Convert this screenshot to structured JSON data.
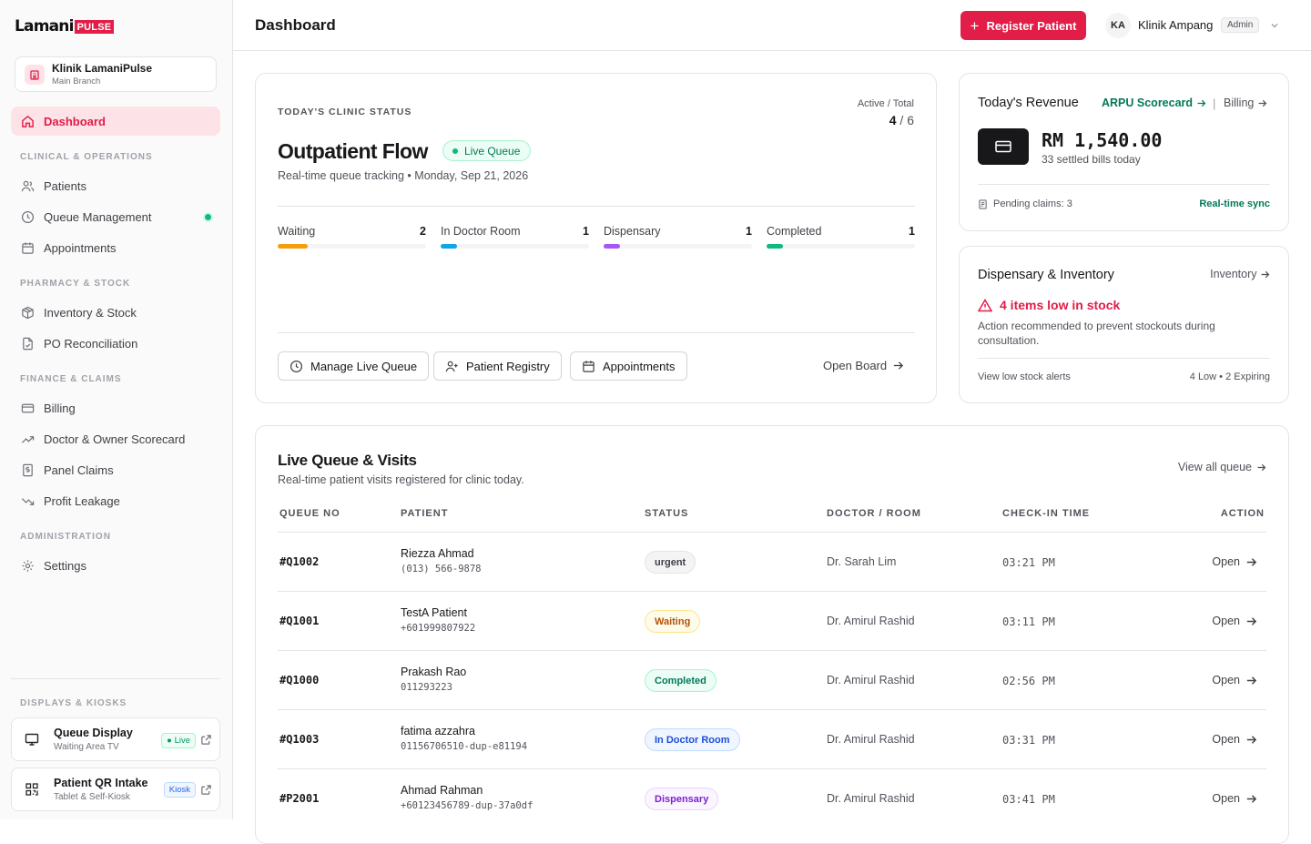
{
  "brand": {
    "name": "Lamani",
    "pulse": "PULSE",
    "accent": "#e11d48"
  },
  "branch": {
    "name": "Klinik LamaniPulse",
    "sub": "Main Branch"
  },
  "sidebar": {
    "dashboard": "Dashboard",
    "sections": {
      "clinical": "CLINICAL & OPERATIONS",
      "pharmacy": "PHARMACY & STOCK",
      "finance": "FINANCE & CLAIMS",
      "admin": "ADMINISTRATION",
      "displays": "DISPLAYS & KIOSKS"
    },
    "items": {
      "patients": "Patients",
      "queue": "Queue Management",
      "appointments": "Appointments",
      "inventory": "Inventory & Stock",
      "po": "PO Reconciliation",
      "billing": "Billing",
      "scorecard": "Doctor & Owner Scorecard",
      "panel": "Panel Claims",
      "leakage": "Profit Leakage",
      "settings": "Settings"
    },
    "kiosks": [
      {
        "title": "Queue Display",
        "sub": "Waiting Area TV",
        "badge": "Live",
        "icon": "monitor-icon"
      },
      {
        "title": "Patient QR Intake",
        "sub": "Tablet & Self-Kiosk",
        "badge": "Kiosk",
        "icon": "qr-code-icon"
      }
    ]
  },
  "header": {
    "title": "Dashboard",
    "register": "Register Patient",
    "avatar": "KA",
    "clinic": "Klinik Ampang",
    "role": "Admin"
  },
  "status": {
    "eyebrow": "TODAY'S CLINIC STATUS",
    "active_label": "Active / Total",
    "active": "4",
    "total": "/ 6",
    "title": "Outpatient Flow",
    "badge": "Live Queue",
    "sub": "Real-time queue tracking • Monday, Sep 21, 2026",
    "stages": [
      {
        "label": "Waiting",
        "count": "2",
        "fill": 0.2,
        "color": "#f59e0b"
      },
      {
        "label": "In Doctor Room",
        "count": "1",
        "fill": 0.11,
        "color": "#0ea5e9"
      },
      {
        "label": "Dispensary",
        "count": "1",
        "fill": 0.11,
        "color": "#a855f7"
      },
      {
        "label": "Completed",
        "count": "1",
        "fill": 0.11,
        "color": "#10b981"
      }
    ],
    "actions": {
      "manage": "Manage Live Queue",
      "registry": "Patient Registry",
      "appointments": "Appointments",
      "board": "Open Board"
    }
  },
  "revenue": {
    "title": "Today's Revenue",
    "arpu": "ARPU Scorecard",
    "sep": "|",
    "billing": "Billing",
    "amount": "RM 1,540.00",
    "sub": "33 settled bills today",
    "pending": "Pending claims: 3",
    "sync": "Real-time sync"
  },
  "inventory": {
    "title": "Dispensary & Inventory",
    "link": "Inventory",
    "alert": "4 items low in stock",
    "desc": "Action recommended to prevent stockouts during consultation.",
    "view": "View low stock alerts",
    "counts": "4 Low • 2 Expiring"
  },
  "queue": {
    "title": "Live Queue & Visits",
    "sub": "Real-time patient visits registered for clinic today.",
    "view_all": "View all queue",
    "columns": [
      "QUEUE NO",
      "PATIENT",
      "STATUS",
      "DOCTOR / ROOM",
      "CHECK-IN TIME",
      "ACTION"
    ],
    "rows": [
      {
        "no": "#Q1002",
        "name": "Riezza Ahmad",
        "phone": "(013) 566-9878",
        "status": "urgent",
        "tone": "urgent",
        "doctor": "Dr. Sarah Lim",
        "time": "03:21 PM",
        "action": "Open"
      },
      {
        "no": "#Q1001",
        "name": "TestA Patient",
        "phone": "+601999807922",
        "status": "Waiting",
        "tone": "waiting",
        "doctor": "Dr. Amirul Rashid",
        "time": "03:11 PM",
        "action": "Open"
      },
      {
        "no": "#Q1000",
        "name": "Prakash Rao",
        "phone": "011293223",
        "status": "Completed",
        "tone": "completed",
        "doctor": "Dr. Amirul Rashid",
        "time": "02:56 PM",
        "action": "Open"
      },
      {
        "no": "#Q1003",
        "name": "fatima azzahra",
        "phone": "01156706510-dup-e81194",
        "status": "In Doctor Room",
        "tone": "doctor",
        "doctor": "Dr. Amirul Rashid",
        "time": "03:31 PM",
        "action": "Open"
      },
      {
        "no": "#P2001",
        "name": "Ahmad Rahman",
        "phone": "+60123456789-dup-37a0df",
        "status": "Dispensary",
        "tone": "dispensary",
        "doctor": "Dr. Amirul Rashid",
        "time": "03:41 PM",
        "action": "Open"
      }
    ]
  }
}
